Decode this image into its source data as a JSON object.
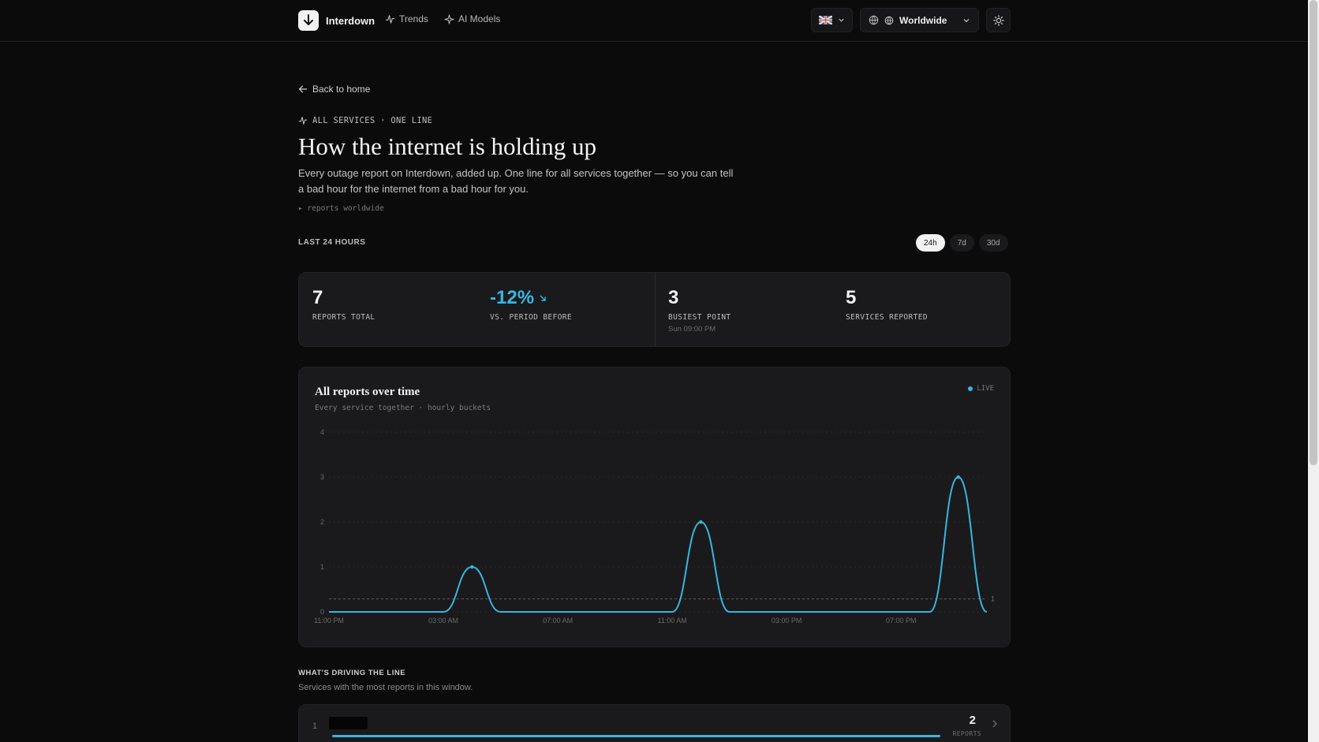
{
  "nav": {
    "brand": "Interdown",
    "links": [
      {
        "label": "Trends",
        "icon": "activity-icon"
      },
      {
        "label": "AI Models",
        "icon": "sparkles-icon"
      }
    ],
    "language_icon": "uk-flag-icon",
    "region": "Worldwide",
    "theme_icon": "sun-icon"
  },
  "page": {
    "back_label": "Back to home",
    "eyebrow": "ALL SERVICES · ONE LINE",
    "title": "How the internet is holding up",
    "lead": "Every outage report on Interdown, added up. One line for all services together — so you can tell a bad hour for the internet from a bad hour for you.",
    "hint": "▸ reports worldwide"
  },
  "period": {
    "label": "LAST 24 HOURS",
    "ranges": [
      "24h",
      "7d",
      "30d"
    ],
    "active": "24h"
  },
  "stats": [
    {
      "value": "7",
      "label": "REPORTS TOTAL",
      "sub": ""
    },
    {
      "value": "-12%",
      "label": "VS. PERIOD BEFORE",
      "sub": ""
    },
    {
      "value": "3",
      "label": "BUSIEST POINT",
      "sub": "Sun 09:00 PM"
    },
    {
      "value": "5",
      "label": "SERVICES REPORTED",
      "sub": ""
    }
  ],
  "chart": {
    "title": "All reports over time",
    "subtitle": "Every service together · hourly buckets",
    "live_label": "LIVE"
  },
  "chart_data": {
    "type": "line",
    "x": [
      "11:00 PM",
      "12:00 AM",
      "01:00 AM",
      "02:00 AM",
      "03:00 AM",
      "04:00 AM",
      "05:00 AM",
      "06:00 AM",
      "07:00 AM",
      "08:00 AM",
      "09:00 AM",
      "10:00 AM",
      "11:00 AM",
      "12:00 PM",
      "01:00 PM",
      "02:00 PM",
      "03:00 PM",
      "04:00 PM",
      "05:00 PM",
      "06:00 PM",
      "07:00 PM",
      "08:00 PM",
      "09:00 PM",
      "10:00 PM"
    ],
    "values": [
      0,
      0,
      0,
      0,
      0,
      1,
      0,
      0,
      0,
      0,
      0,
      0,
      0,
      2,
      0,
      0,
      0,
      0,
      0,
      0,
      0,
      0,
      3,
      0
    ],
    "tick_labels_x": [
      "11:00 PM",
      "03:00 AM",
      "07:00 AM",
      "11:00 AM",
      "03:00 PM",
      "07:00 PM"
    ],
    "y_ticks": [
      0,
      1,
      2,
      3,
      4
    ],
    "ylim": [
      0,
      4
    ],
    "reference_line": {
      "value": 0.29,
      "label": "1"
    },
    "color": "#38b6df",
    "grid": true
  },
  "drivers": {
    "title": "WHAT'S DRIVING THE LINE",
    "subtitle": "Services with the most reports in this window.",
    "rows": [
      {
        "rank": "1",
        "count": "2",
        "count_label": "REPORTS",
        "share": 1.0
      }
    ]
  }
}
